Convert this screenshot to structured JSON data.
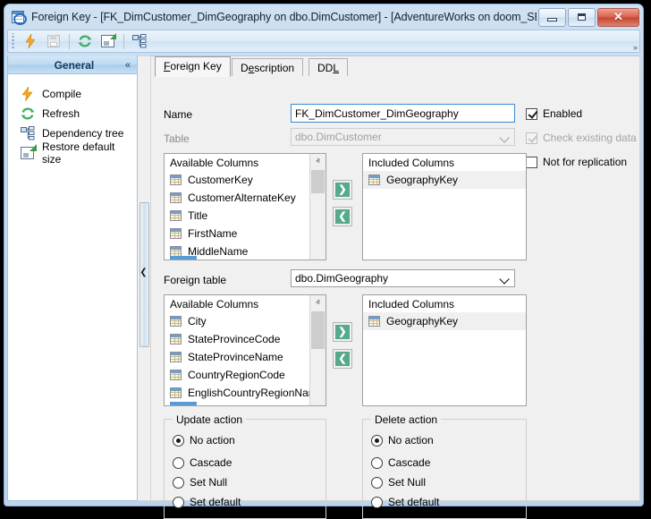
{
  "window": {
    "title": "Foreign Key - [FK_DimCustomer_DimGeography on dbo.DimCustomer] - [AdventureWorks on doom_SERV...",
    "icon": "foreign-key-icon",
    "buttons": {
      "minimize": "–",
      "maximize": "□",
      "close": "✕"
    }
  },
  "toolbar": {
    "items": [
      {
        "name": "compile-toolbar-button",
        "icon": "lightning-bolt-icon",
        "enabled": true
      },
      {
        "name": "save-toolbar-button",
        "icon": "save-icon",
        "enabled": false
      },
      {
        "name": "refresh-toolbar-button",
        "icon": "refresh-icon",
        "enabled": true
      },
      {
        "name": "restore-default-size-toolbar-button",
        "icon": "restore-window-icon",
        "enabled": true
      },
      {
        "name": "dependency-tree-toolbar-button",
        "icon": "dependency-tree-icon",
        "enabled": true
      }
    ],
    "overflow": "»"
  },
  "sidebar": {
    "title": "General",
    "collapse_glyph": "«",
    "items": [
      {
        "label": "Compile",
        "icon": "lightning-bolt-icon"
      },
      {
        "label": "Refresh",
        "icon": "refresh-icon"
      },
      {
        "label": "Dependency tree",
        "icon": "dependency-tree-icon"
      },
      {
        "label": "Restore default size",
        "icon": "restore-window-icon"
      }
    ]
  },
  "splitter": {
    "chevron": "❮"
  },
  "tabs": [
    {
      "id": "foreign-key",
      "label": "Foreign Key",
      "accel": "F",
      "active": true
    },
    {
      "id": "description",
      "label": "Description",
      "accel": "D",
      "active": false
    },
    {
      "id": "ddl",
      "label": "DDL",
      "accel": "L",
      "active": false
    }
  ],
  "form": {
    "name_label": "Name",
    "name_accel": "N",
    "name_value": "FK_DimCustomer_DimGeography",
    "table_label": "Table",
    "table_value": "dbo.DimCustomer",
    "table_enabled": false,
    "foreign_table_label": "Foreign table",
    "foreign_table_value": "dbo.DimGeography"
  },
  "checkboxes": [
    {
      "label": "Enabled",
      "checked": true,
      "enabled": true
    },
    {
      "label": "Check existing data",
      "checked": true,
      "enabled": false
    },
    {
      "label": "Not for replication",
      "checked": false,
      "enabled": true
    }
  ],
  "local_columns": {
    "available_header": "Available Columns",
    "available_items": [
      "CustomerKey",
      "CustomerAlternateKey",
      "Title",
      "FirstName",
      "MiddleName"
    ],
    "included_header": "Included Columns",
    "included_items": [
      "GeographyKey"
    ]
  },
  "foreign_columns": {
    "available_header": "Available Columns",
    "available_items": [
      "City",
      "StateProvinceCode",
      "StateProvinceName",
      "CountryRegionCode",
      "EnglishCountryRegionName"
    ],
    "included_header": "Included Columns",
    "included_items": [
      "GeographyKey"
    ]
  },
  "transfer_buttons": {
    "add_glyph": "❯",
    "remove_glyph": "❮"
  },
  "scrollbar": {
    "up_glyph": "ⱏ",
    "down_glyph": "ⱟ"
  },
  "update_action": {
    "title": "Update action",
    "options": [
      "No action",
      "Cascade",
      "Set Null",
      "Set default"
    ],
    "selected": "No action"
  },
  "delete_action": {
    "title": "Delete action",
    "options": [
      "No action",
      "Cascade",
      "Set Null",
      "Set default"
    ],
    "selected": "No action"
  },
  "colors": {
    "accent": "#3c8bd0",
    "green_button": "#56a98a",
    "title_bar": "#c2d8ef",
    "close_button": "#c24631"
  }
}
